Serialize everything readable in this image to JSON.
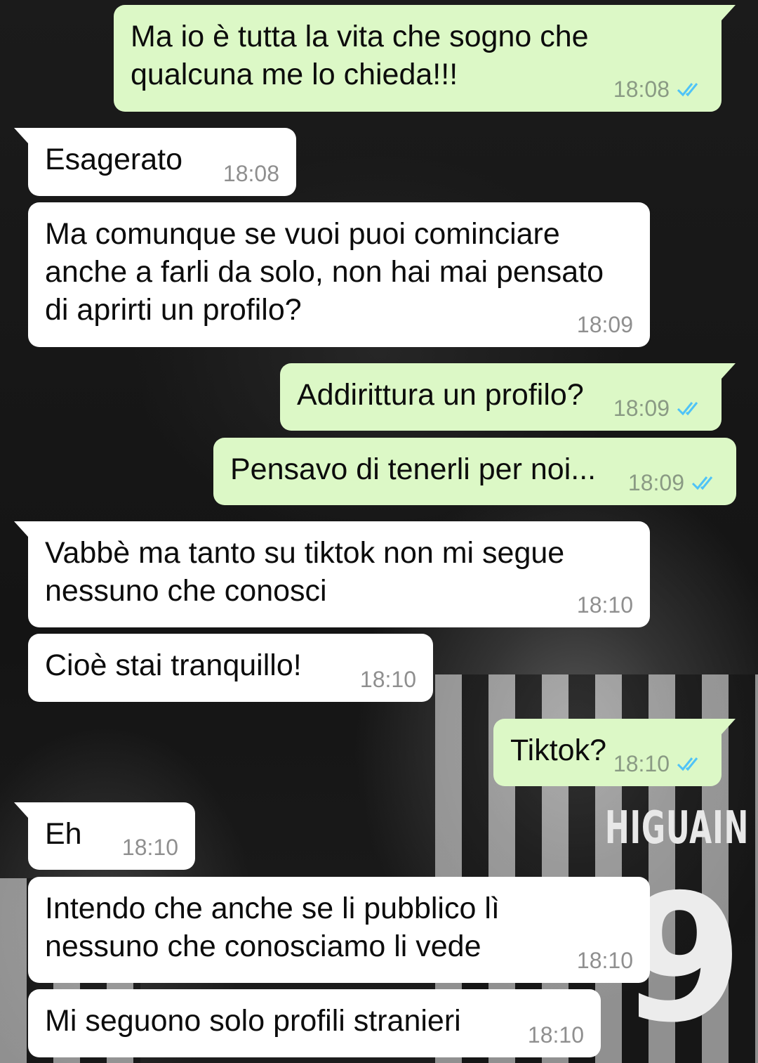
{
  "wallpaper": {
    "name_on_jersey": "HIGUAIN",
    "number_on_jersey": "9"
  },
  "colors": {
    "incoming_bubble": "#ffffff",
    "outgoing_bubble": "#dcf8c6",
    "read_ticks": "#4fc3f7",
    "timestamp": "#8f8f8f"
  },
  "messages": [
    {
      "direction": "out",
      "text": "Ma io è tutta la vita che sogno che\nqualcuna me lo chieda!!!",
      "time": "18:08",
      "status": "read"
    },
    {
      "direction": "in",
      "text": "Esagerato",
      "time": "18:08"
    },
    {
      "direction": "in",
      "text": "Ma comunque se vuoi puoi cominciare\nanche a farli da solo, non hai mai pensato\ndi aprirti un profilo?",
      "time": "18:09"
    },
    {
      "direction": "out",
      "text": "Addirittura un profilo?",
      "time": "18:09",
      "status": "read"
    },
    {
      "direction": "out",
      "text": "Pensavo di tenerli per noi...",
      "time": "18:09",
      "status": "read"
    },
    {
      "direction": "in",
      "text": "Vabbè ma tanto su tiktok non mi segue\nnessuno che conosci",
      "time": "18:10"
    },
    {
      "direction": "in",
      "text": "Cioè stai tranquillo!",
      "time": "18:10"
    },
    {
      "direction": "out",
      "text": "Tiktok?",
      "time": "18:10",
      "status": "read"
    },
    {
      "direction": "in",
      "text": "Eh",
      "time": "18:10"
    },
    {
      "direction": "in",
      "text": "Intendo che anche se li pubblico lì\nnessuno che conosciamo li vede",
      "time": "18:10"
    },
    {
      "direction": "in",
      "text": "Mi seguono solo profili stranieri",
      "time": "18:10"
    }
  ]
}
